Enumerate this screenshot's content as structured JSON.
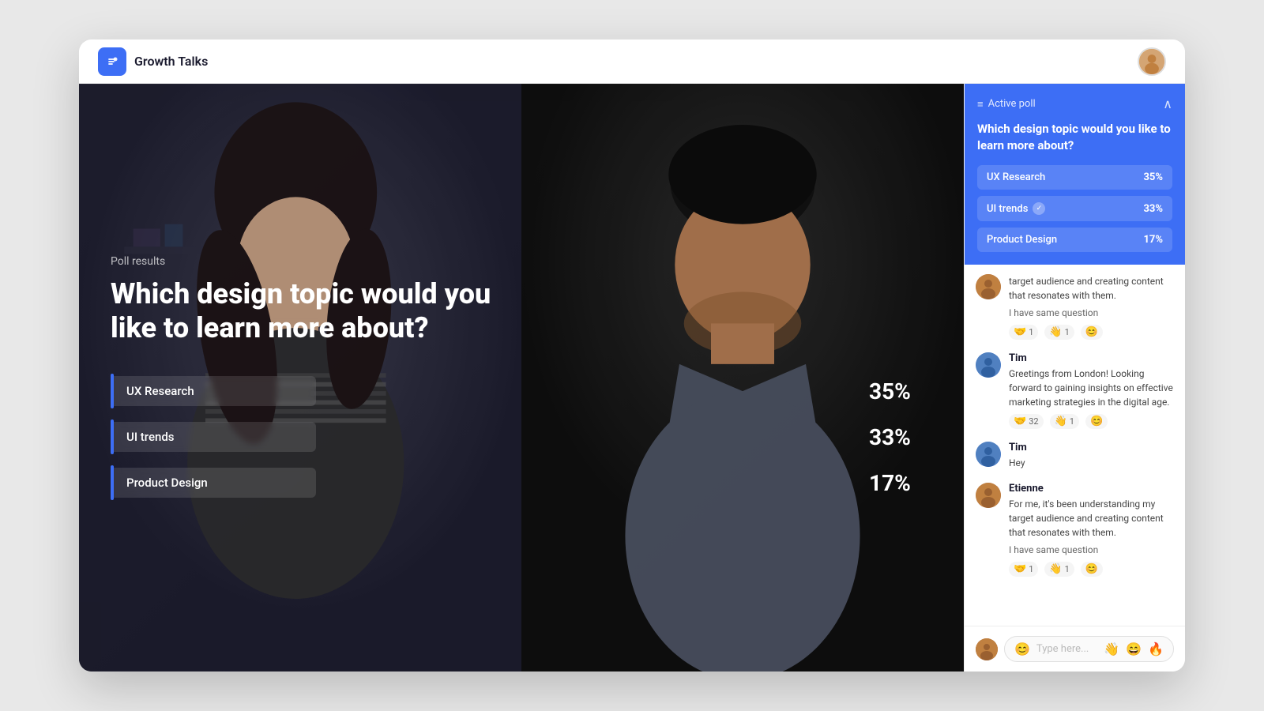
{
  "header": {
    "app_title": "Growth Talks",
    "logo_symbol": "💬"
  },
  "poll": {
    "results_label": "Poll results",
    "question": "Which design topic would you like to learn more about?",
    "options": [
      {
        "label": "UX Research",
        "percentage": "35%"
      },
      {
        "label": "UI trends",
        "percentage": "33%"
      },
      {
        "label": "Product Design",
        "percentage": "17%"
      }
    ]
  },
  "active_poll": {
    "label": "Active poll",
    "question": "Which design topic would you like to learn more about?",
    "options": [
      {
        "label": "UX Research",
        "percentage": "35%",
        "checked": false
      },
      {
        "label": "UI trends",
        "percentage": "33%",
        "checked": true
      },
      {
        "label": "Product Design",
        "percentage": "17%",
        "checked": false
      }
    ]
  },
  "chat": {
    "messages": [
      {
        "id": "msg1",
        "author": "",
        "avatar_class": "avatar-etienne",
        "text": "target audience and creating content that resonates with them.",
        "sub_text": "I have same question",
        "reactions": [
          {
            "emoji": "🤝",
            "count": "1"
          },
          {
            "emoji": "👋",
            "count": "1"
          },
          {
            "emoji": "😊",
            "count": ""
          }
        ]
      },
      {
        "id": "msg2",
        "author": "Tim",
        "avatar_class": "avatar-tim",
        "text": "Greetings from London! Looking forward to gaining insights on effective marketing strategies in the digital age.",
        "reactions": [
          {
            "emoji": "🤝",
            "count": "32"
          },
          {
            "emoji": "👋",
            "count": "1"
          },
          {
            "emoji": "😊",
            "count": ""
          }
        ]
      },
      {
        "id": "msg3",
        "author": "Tim",
        "avatar_class": "avatar-tim",
        "text": "Hey",
        "reactions": []
      },
      {
        "id": "msg4",
        "author": "Etienne",
        "avatar_class": "avatar-etienne",
        "text": "For me, it's been understanding my target audience and creating content that resonates with them.",
        "sub_text": "I have same question",
        "reactions": [
          {
            "emoji": "🤝",
            "count": "1"
          },
          {
            "emoji": "👋",
            "count": "1"
          },
          {
            "emoji": "😊",
            "count": ""
          }
        ]
      }
    ],
    "input_placeholder": "Type here...",
    "input_icons": [
      "👋",
      "😄",
      "🔥"
    ]
  }
}
